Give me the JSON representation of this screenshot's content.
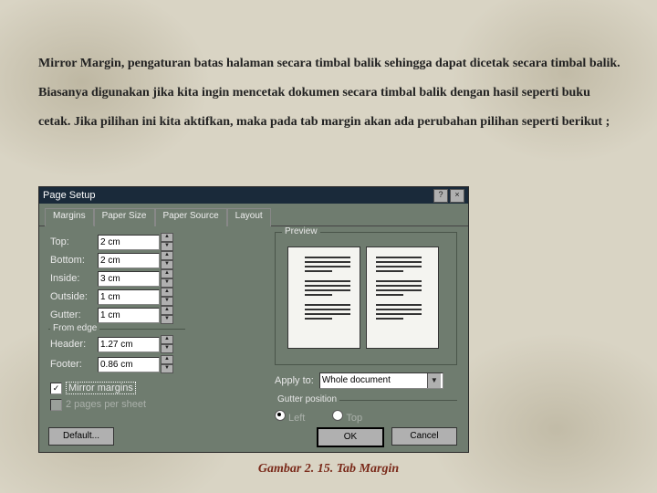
{
  "paragraph": "Mirror Margin, pengaturan batas halaman secara timbal balik sehingga dapat dicetak secara timbal balik. Biasanya digunakan jika kita ingin mencetak dokumen secara timbal balik dengan hasil seperti buku cetak. Jika pilihan ini kita aktifkan, maka pada tab margin akan ada perubahan pilihan seperti berikut ;",
  "caption": "Gambar 2. 15. Tab Margin",
  "dialog": {
    "title": "Page Setup",
    "help_icon": "?",
    "close_icon": "×",
    "tabs": [
      "Margins",
      "Paper Size",
      "Paper Source",
      "Layout"
    ],
    "active_tab": 0,
    "fields": {
      "top": {
        "label": "Top:",
        "value": "2 cm"
      },
      "bottom": {
        "label": "Bottom:",
        "value": "2 cm"
      },
      "inside": {
        "label": "Inside:",
        "value": "3 cm"
      },
      "outside": {
        "label": "Outside:",
        "value": "1 cm"
      },
      "gutter": {
        "label": "Gutter:",
        "value": "1 cm"
      },
      "header": {
        "label": "Header:",
        "value": "1.27 cm"
      },
      "footer": {
        "label": "Footer:",
        "value": "0.86 cm"
      }
    },
    "from_edge_label": "From edge",
    "mirror_label": "Mirror margins",
    "two_pages_label": "2 pages per sheet",
    "mirror_checked": true,
    "two_pages_checked": false,
    "preview_label": "Preview",
    "apply_to_label": "Apply to:",
    "apply_to_value": "Whole document",
    "gutter_pos_label": "Gutter position",
    "gutter_left": "Left",
    "gutter_top": "Top",
    "gutter_selected": "left",
    "default_btn": "Default...",
    "ok_btn": "OK",
    "cancel_btn": "Cancel"
  }
}
